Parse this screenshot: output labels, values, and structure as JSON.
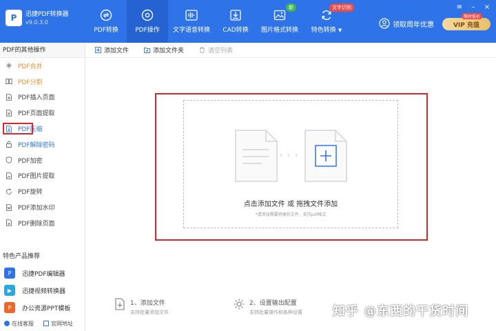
{
  "app": {
    "name": "迅捷PDF转换器",
    "version": "v9.0.3.0",
    "logo_letter": "P"
  },
  "nav": {
    "items": [
      {
        "label": "PDF转换",
        "icon": "convert-icon",
        "active": false
      },
      {
        "label": "PDF操作",
        "icon": "gear-icon",
        "active": true
      },
      {
        "label": "文字语音转换",
        "icon": "audio-icon",
        "active": false
      },
      {
        "label": "CAD转换",
        "icon": "cad-icon",
        "active": false
      },
      {
        "label": "图片格式转换",
        "icon": "image-icon",
        "active": false,
        "badge": "新"
      },
      {
        "label": "特色转换",
        "icon": "refresh-icon",
        "active": false,
        "badge": "文字识别",
        "caret": "▼"
      }
    ]
  },
  "header": {
    "coupon_label": "领取周年优惠",
    "vip_label": "VIP  充值",
    "vip_tag": "限时低价"
  },
  "sidebar": {
    "heading": "PDF的其他操作",
    "items": [
      {
        "label": "PDF合并",
        "icon": "merge-icon",
        "color": "orange"
      },
      {
        "label": "PDF分割",
        "icon": "split-icon",
        "color": "orange"
      },
      {
        "label": "PDF插入页面",
        "icon": "insert-page-icon",
        "color": "default"
      },
      {
        "label": "PDF页面提取",
        "icon": "extract-page-icon",
        "color": "default"
      },
      {
        "label": "PDF压缩",
        "icon": "compress-icon",
        "color": "selected"
      },
      {
        "label": "PDF解除密码",
        "icon": "unlock-icon",
        "color": "blue"
      },
      {
        "label": "PDF加密",
        "icon": "shield-icon",
        "color": "default"
      },
      {
        "label": "PDF图片提取",
        "icon": "image-extract-icon",
        "color": "default"
      },
      {
        "label": "PDF旋转",
        "icon": "rotate-icon",
        "color": "default"
      },
      {
        "label": "PDF添加水印",
        "icon": "watermark-icon",
        "color": "default"
      },
      {
        "label": "PDF删除页面",
        "icon": "delete-page-icon",
        "color": "default"
      }
    ],
    "features_heading": "特色产品推荐",
    "features": [
      {
        "label": "迅捷PDF编辑器",
        "icon": "pdf-editor-icon",
        "color": "#2e73e8"
      },
      {
        "label": "迅捷视频转换器",
        "icon": "video-converter-icon",
        "color": "#2aa8e0"
      },
      {
        "label": "办公资源PPT模板",
        "icon": "ppt-template-icon",
        "color": "#e8692e"
      }
    ],
    "footer": {
      "service": "在线客服",
      "website": "官网地址"
    }
  },
  "toolbar": {
    "add_file": "添加文件",
    "add_folder": "添加文件夹",
    "clear_list": "清空列表"
  },
  "dropzone": {
    "title": "点击添加文件 或 拖拽文件添加",
    "subtitle": "*请添加需要转换的文件，支持pdf格式",
    "arrows": "›  ›  ›"
  },
  "steps": [
    {
      "title": "1、添加文件",
      "sub": "支持批量添加文件"
    },
    {
      "title": "2、设置输出配置",
      "sub": "支持批量操作和各种设置"
    }
  ],
  "watermark": "知乎 @东西的干货时间",
  "colors": {
    "primary": "#2e73e8",
    "highlight_red": "#d8262d",
    "orange": "#e8912e"
  }
}
